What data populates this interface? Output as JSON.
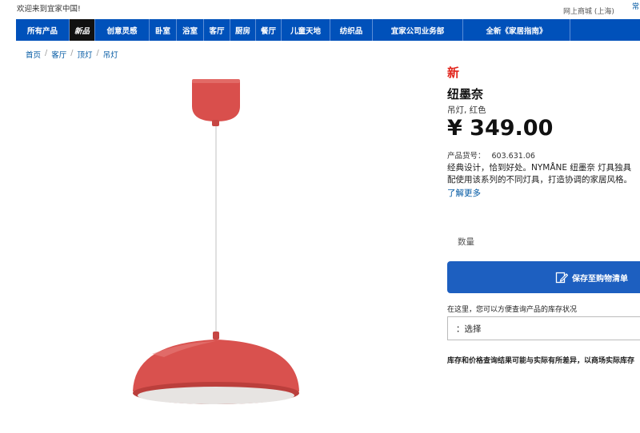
{
  "topbar": {
    "welcome": "欢迎来到宜家中国!",
    "store": "网上商城 (上海)",
    "help": "常"
  },
  "nav": [
    {
      "label": "所有产品"
    },
    {
      "label": "新品"
    },
    {
      "label": "创意灵感"
    },
    {
      "label": "卧室"
    },
    {
      "label": "浴室"
    },
    {
      "label": "客厅"
    },
    {
      "label": "厨房"
    },
    {
      "label": "餐厅"
    },
    {
      "label": "儿童天地"
    },
    {
      "label": "纺织品"
    },
    {
      "label": "宜家公司业务部"
    },
    {
      "label": "全新《家居指南》"
    }
  ],
  "breadcrumb": [
    "首页",
    "客厅",
    "顶灯",
    "吊灯"
  ],
  "product": {
    "badge": "新",
    "name": "纽墨奈",
    "subtitle": "吊灯, 红色",
    "price": "¥ 349.00",
    "article_label": "产品货号：",
    "article_number": "603.631.06",
    "desc_line1": "经典设计，恰到好处。NYMÅNE 纽墨奈 灯具独具",
    "desc_line2": "配使用该系列的不同灯具，打造协调的家居风格。",
    "more": "了解更多",
    "lamp_color": "#d9514e"
  },
  "purchase": {
    "quantity_label": "数量",
    "save_button": "保存至购物清单",
    "stock_hint": "在这里，您可以方便查询产品的库存状况",
    "store_select": "：选择",
    "disclaimer": "库存和价格查询结果可能与实际有所差异，以商场实际库存"
  },
  "colors": {
    "nav_bg": "#0051ba",
    "accent_red": "#e2231a",
    "button_blue": "#1d5fc0",
    "link_blue": "#0058a3"
  }
}
